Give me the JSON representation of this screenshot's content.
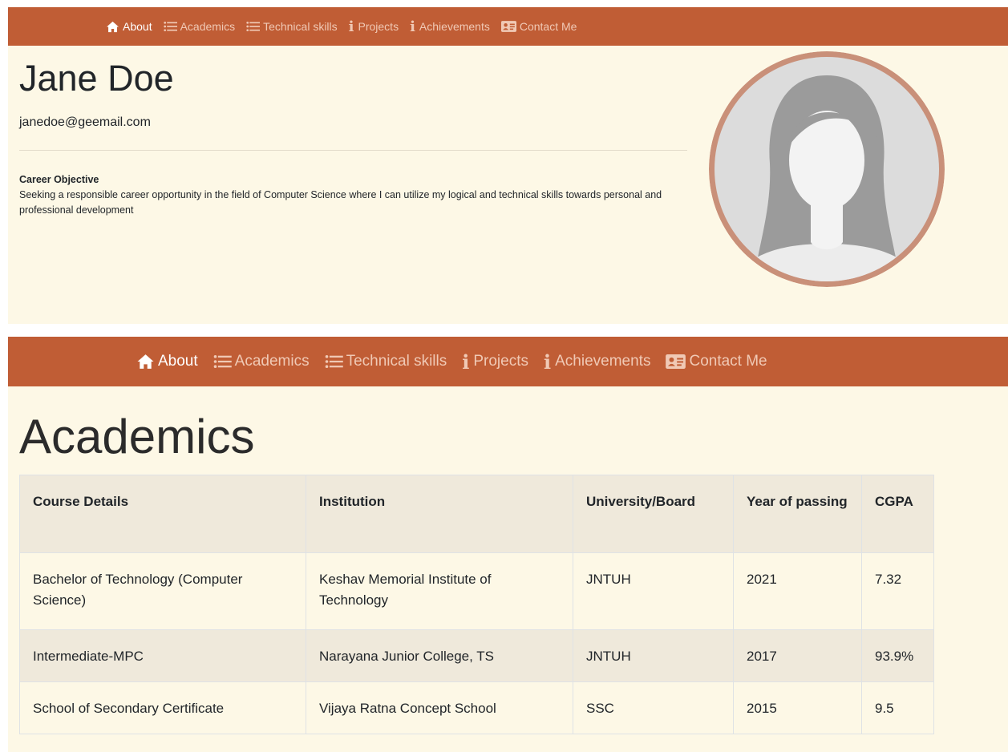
{
  "nav": {
    "items": [
      {
        "label": "About",
        "icon": "home-icon",
        "active": true
      },
      {
        "label": "Academics",
        "icon": "list-icon",
        "active": false
      },
      {
        "label": "Technical skills",
        "icon": "list-icon",
        "active": false
      },
      {
        "label": "Projects",
        "icon": "info-icon",
        "active": false
      },
      {
        "label": "Achievements",
        "icon": "info-icon",
        "active": false
      },
      {
        "label": "Contact Me",
        "icon": "contact-card-icon",
        "active": false
      }
    ]
  },
  "about": {
    "name": "Jane Doe",
    "email": "janedoe@geemail.com",
    "objective_title": "Career Objective",
    "objective_text": "Seeking a responsible career opportunity in the field of Computer Science where I can utilize my logical and technical skills towards personal and professional development",
    "avatar_icon": "female-avatar-icon"
  },
  "academics": {
    "title": "Academics",
    "columns": [
      "Course Details",
      "Institution",
      "University/Board",
      "Year of passing",
      "CGPA"
    ],
    "rows": [
      [
        "Bachelor of Technology (Computer Science)",
        "Keshav Memorial Institute of Technology",
        "JNTUH",
        "2021",
        "7.32"
      ],
      [
        "Intermediate-MPC",
        "Narayana Junior College, TS",
        "JNTUH",
        "2017",
        "93.9%"
      ],
      [
        "School of Secondary Certificate",
        "Vijaya Ratna Concept School",
        "SSC",
        "2015",
        "9.5"
      ]
    ]
  },
  "colors": {
    "navbar": "#c05d35",
    "nav_active": "#ffffff",
    "nav_inactive": "#f0c9b5",
    "page_background": "#fdf8e6",
    "avatar_border": "#c99079",
    "table_header": "#efe9db"
  }
}
